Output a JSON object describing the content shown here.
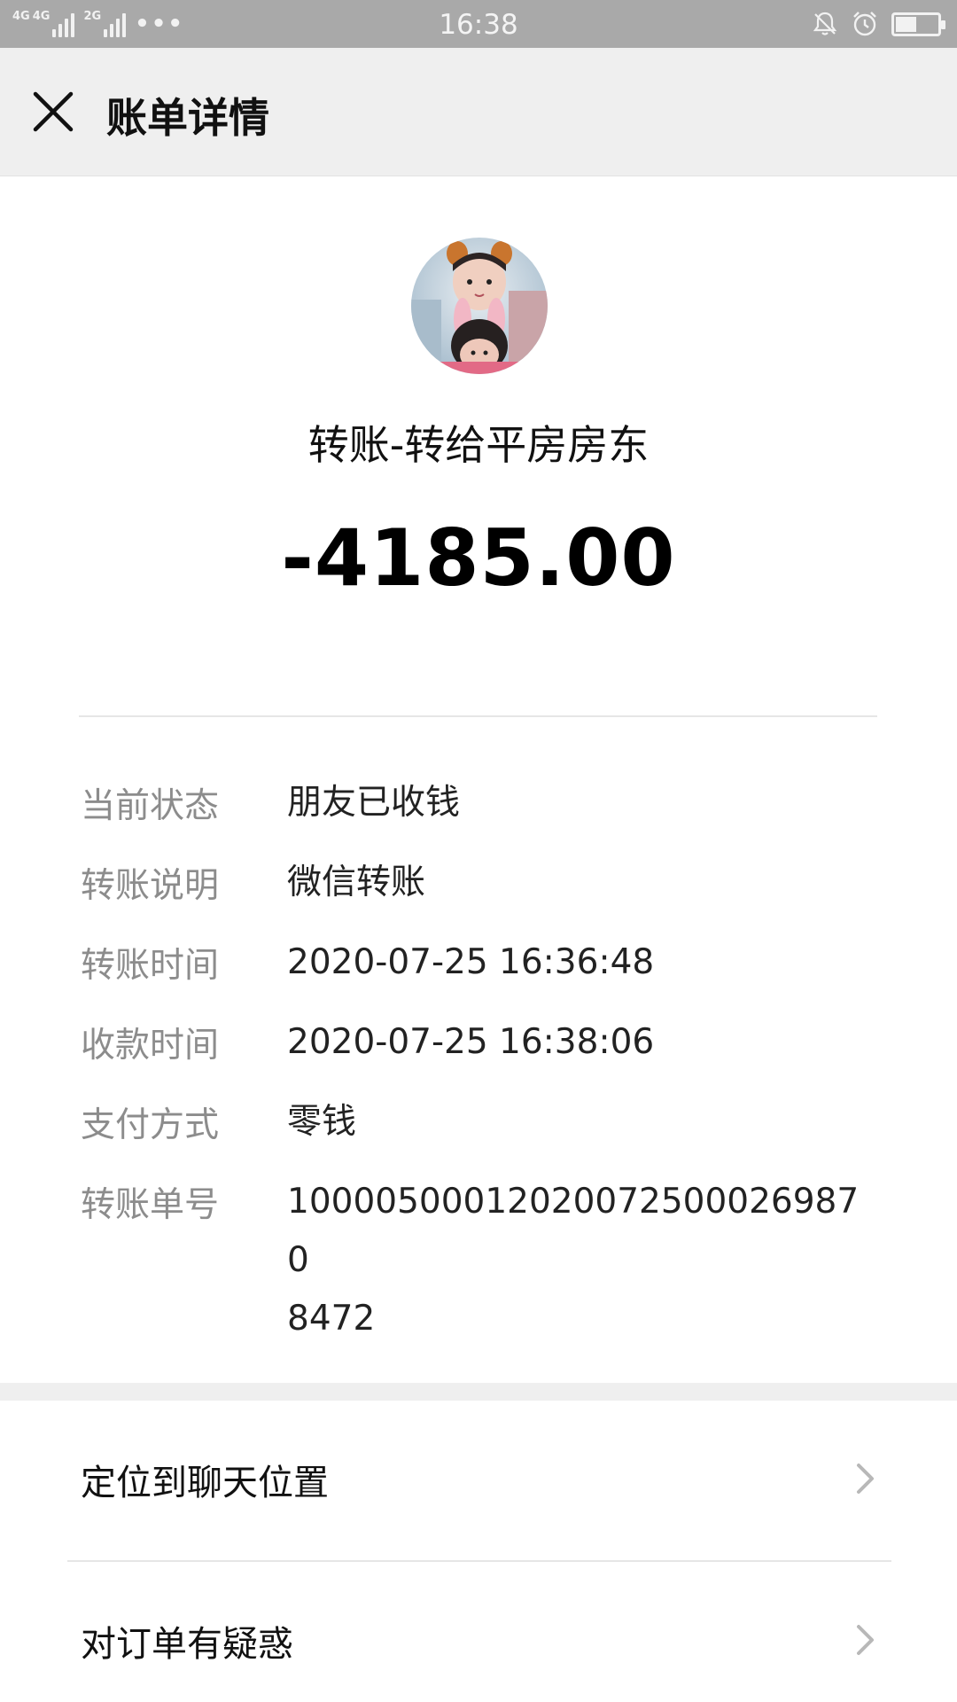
{
  "status_bar": {
    "network_labels": [
      "4G",
      "4G",
      "2G"
    ],
    "time": "16:38",
    "more_dots": "•••",
    "battery_level": 0.45
  },
  "nav": {
    "title": "账单详情"
  },
  "summary": {
    "payee": "转账-转给平房房东",
    "amount": "-4185.00"
  },
  "details": [
    {
      "label": "当前状态",
      "value": "朋友已收钱"
    },
    {
      "label": "转账说明",
      "value": "微信转账"
    },
    {
      "label": "转账时间",
      "value": "2020-07-25 16:36:48"
    },
    {
      "label": "收款时间",
      "value": "2020-07-25 16:38:06"
    },
    {
      "label": "支付方式",
      "value": "零钱"
    },
    {
      "label": "转账单号",
      "value_line1": "10000500012020072500026987 0",
      "value_line2": "8472"
    }
  ],
  "actions": [
    {
      "label": "定位到聊天位置"
    },
    {
      "label": "对订单有疑惑"
    }
  ]
}
